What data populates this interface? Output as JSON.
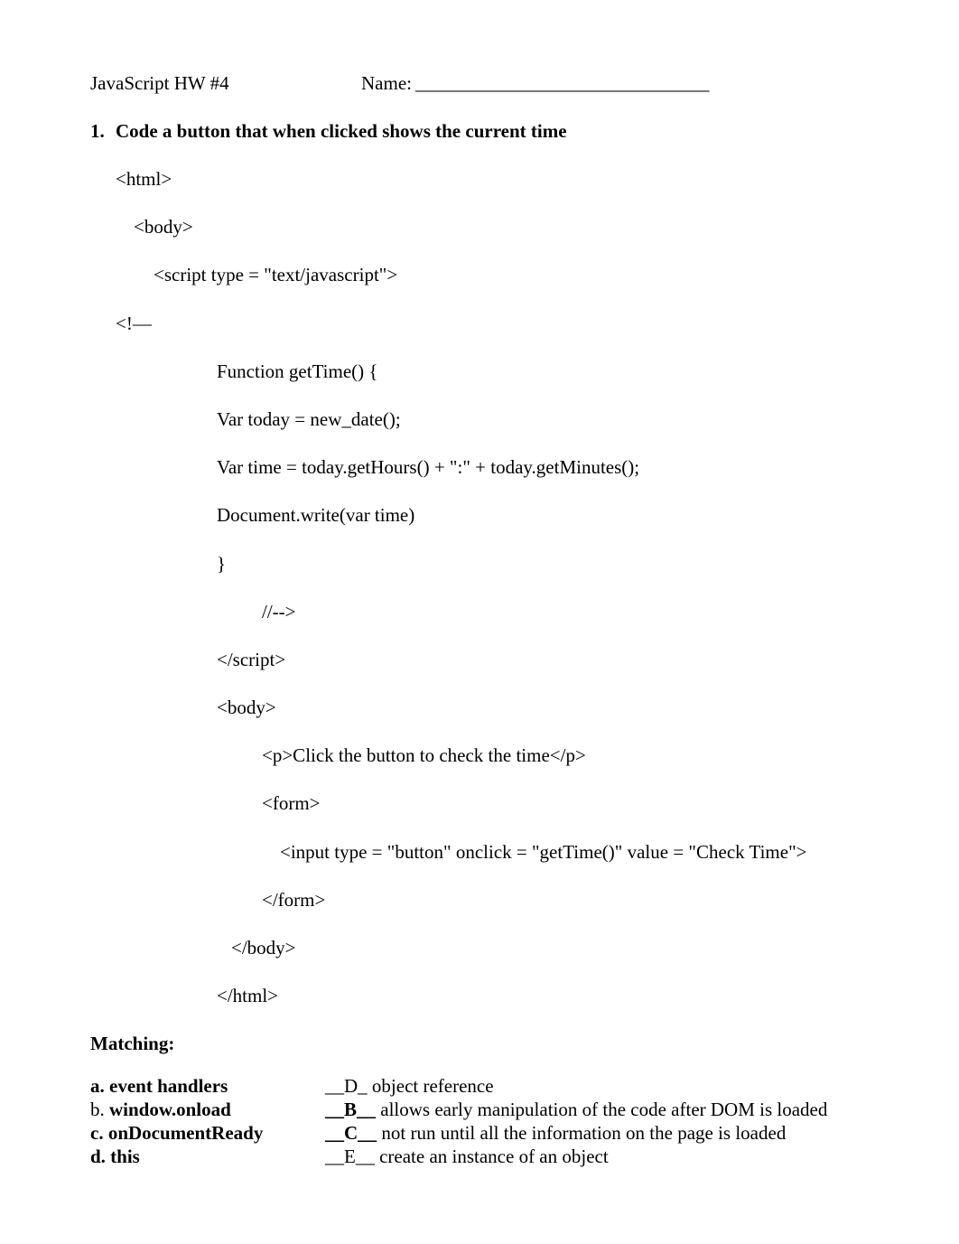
{
  "header": {
    "hw": "JavaScript HW #4",
    "name_label": "Name:",
    "name_blank": "_______________________________"
  },
  "q1": {
    "num": "1.",
    "text": "Code a button that when clicked shows the current time"
  },
  "code": {
    "l01": "<html>",
    "l02": "<body>",
    "l03": "<script type = \"text/javascript\">",
    "l04": "<!—",
    "l05": "Function getTime()     {",
    "l06": "Var today = new_date();",
    "l07": "Var time = today.getHours() + \":\" + today.getMinutes();",
    "l08": "Document.write(var time)",
    "l09": "}",
    "l10": "//-->",
    "l11": "</script>",
    "l12": "<body>",
    "l13": "<p>Click the button to check the time</p>",
    "l14": "<form>",
    "l15": "<input type = \"button\" onclick = \"getTime()\" value = \"Check Time\">",
    "l16": "</form>",
    "l17": "</body>",
    "l18": "</html>"
  },
  "matching": {
    "title": "Matching:",
    "rows": [
      {
        "left": "a. event handlers",
        "left_bold": true,
        "ans": "__D_",
        "ans_bold": false,
        "desc": " object reference"
      },
      {
        "left": "b. window.onload",
        "left_bold": false,
        "ans": "__B__",
        "ans_bold": true,
        "desc": " allows early manipulation of the code after DOM is loaded"
      },
      {
        "left": "c. onDocumentReady",
        "left_bold": true,
        "ans": "__C__",
        "ans_bold": true,
        "desc": " not run until all the information on the page is loaded"
      },
      {
        "left": "d. this",
        "left_bold": true,
        "ans": "__E__",
        "ans_bold": false,
        "desc": " create an instance of an object"
      }
    ]
  }
}
